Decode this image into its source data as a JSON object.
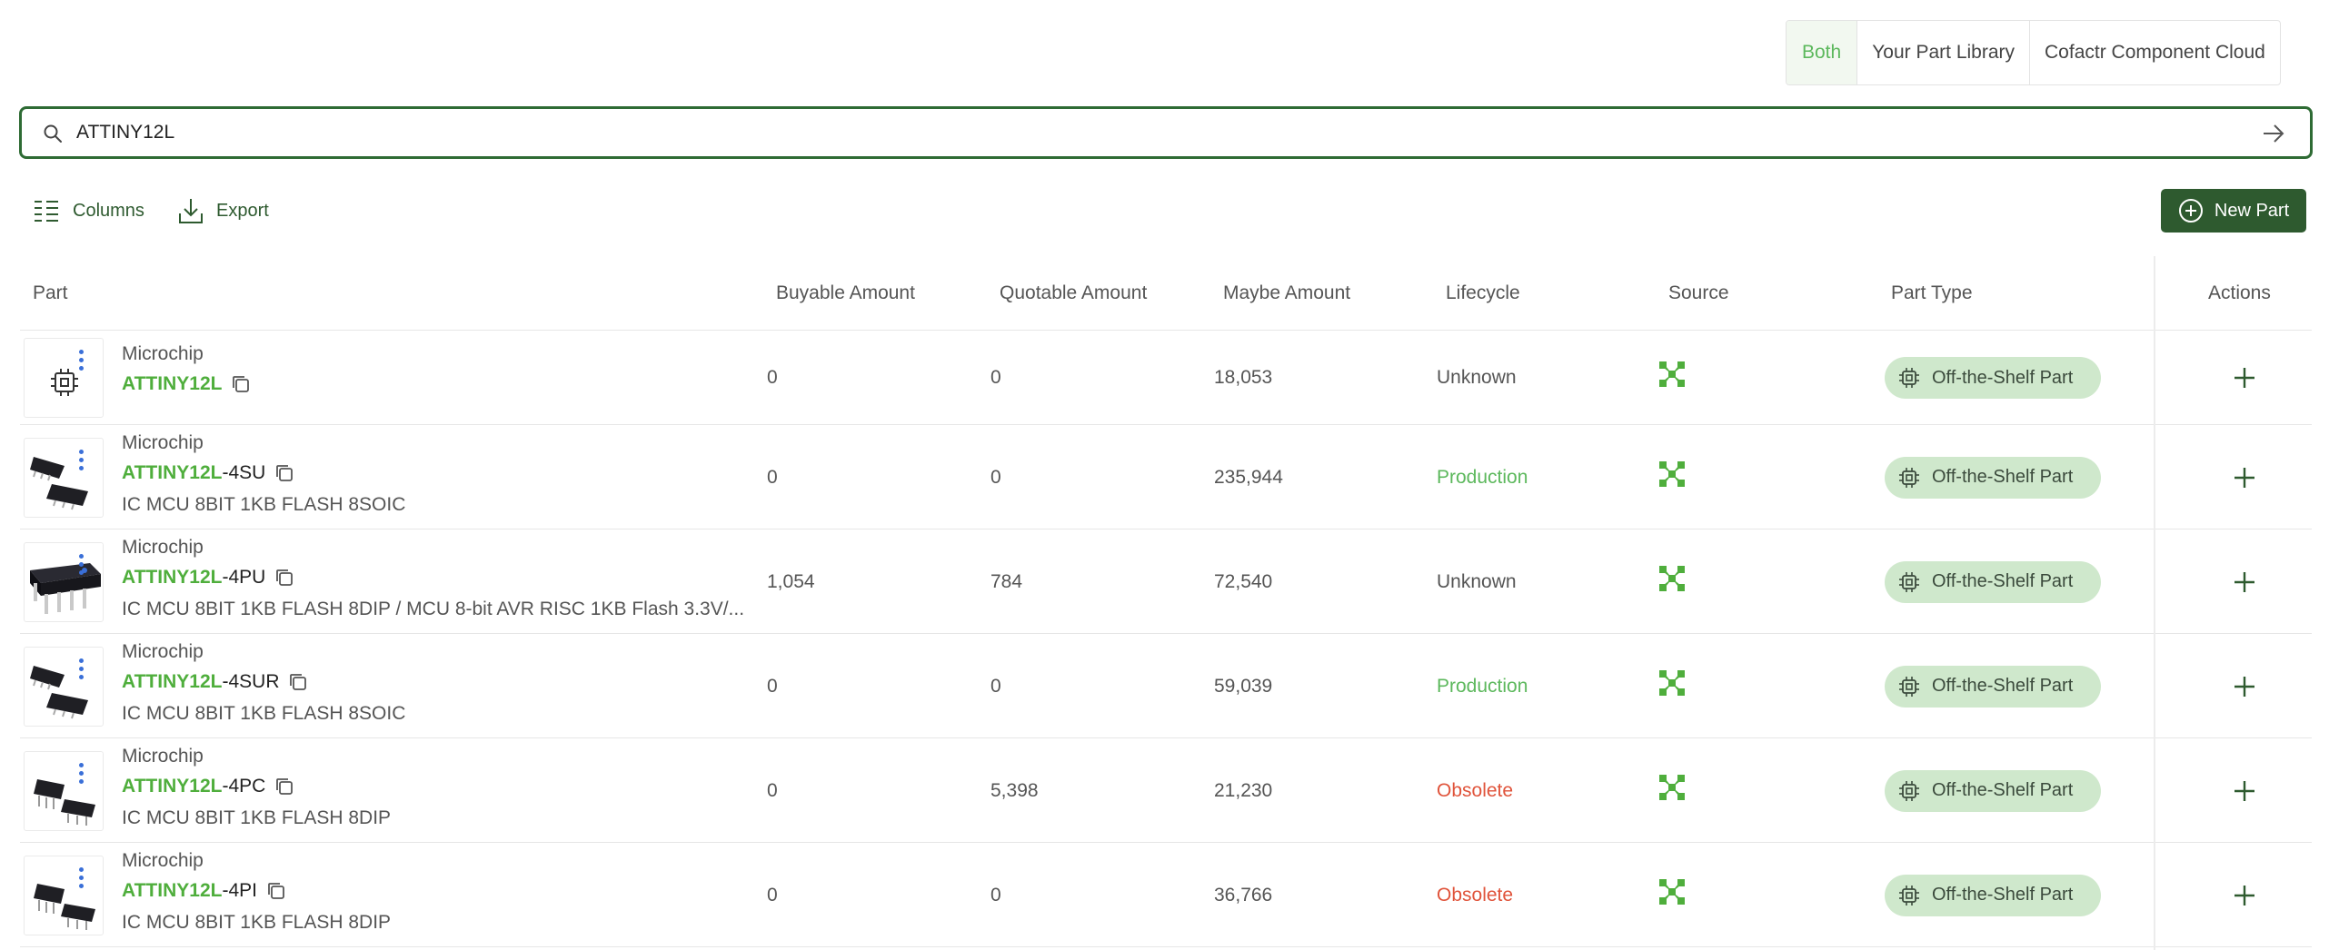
{
  "source_toggle": {
    "options": [
      "Both",
      "Your Part Library",
      "Cofactr Component Cloud"
    ],
    "selected": "Both"
  },
  "search": {
    "value": "ATTINY12L",
    "icon": "search-icon",
    "submit_icon": "arrow-right-icon"
  },
  "toolbar": {
    "columns_label": "Columns",
    "export_label": "Export",
    "new_part_label": "New Part"
  },
  "table": {
    "headers": {
      "part": "Part",
      "buyable": "Buyable Amount",
      "quotable": "Quotable Amount",
      "maybe": "Maybe Amount",
      "lifecycle": "Lifecycle",
      "source": "Source",
      "part_type": "Part Type",
      "actions": "Actions"
    },
    "rows": [
      {
        "manufacturer": "Microchip",
        "pn_match": "ATTINY12L",
        "pn_rest": "",
        "description": "",
        "buyable": "0",
        "quotable": "0",
        "maybe": "18,053",
        "lifecycle": "Unknown",
        "part_type": "Off-the-Shelf Part",
        "image": "chip-icon"
      },
      {
        "manufacturer": "Microchip",
        "pn_match": "ATTINY12L",
        "pn_rest": "-4SU",
        "description": "IC MCU 8BIT 1KB FLASH 8SOIC",
        "buyable": "0",
        "quotable": "0",
        "maybe": "235,944",
        "lifecycle": "Production",
        "part_type": "Off-the-Shelf Part",
        "image": "soic-package"
      },
      {
        "manufacturer": "Microchip",
        "pn_match": "ATTINY12L",
        "pn_rest": "-4PU",
        "description": "IC MCU 8BIT 1KB FLASH 8DIP / MCU 8-bit AVR RISC 1KB Flash 3.3V/...",
        "buyable": "1,054",
        "quotable": "784",
        "maybe": "72,540",
        "lifecycle": "Unknown",
        "part_type": "Off-the-Shelf Part",
        "image": "dip-package"
      },
      {
        "manufacturer": "Microchip",
        "pn_match": "ATTINY12L",
        "pn_rest": "-4SUR",
        "description": "IC MCU 8BIT 1KB FLASH 8SOIC",
        "buyable": "0",
        "quotable": "0",
        "maybe": "59,039",
        "lifecycle": "Production",
        "part_type": "Off-the-Shelf Part",
        "image": "soic-package"
      },
      {
        "manufacturer": "Microchip",
        "pn_match": "ATTINY12L",
        "pn_rest": "-4PC",
        "description": "IC MCU 8BIT 1KB FLASH 8DIP",
        "buyable": "0",
        "quotable": "5,398",
        "maybe": "21,230",
        "lifecycle": "Obsolete",
        "part_type": "Off-the-Shelf Part",
        "image": "dip-package-small"
      },
      {
        "manufacturer": "Microchip",
        "pn_match": "ATTINY12L",
        "pn_rest": "-4PI",
        "description": "IC MCU 8BIT 1KB FLASH 8DIP",
        "buyable": "0",
        "quotable": "0",
        "maybe": "36,766",
        "lifecycle": "Obsolete",
        "part_type": "Off-the-Shelf Part",
        "image": "dip-package-small"
      }
    ]
  },
  "colors": {
    "accent_green": "#4fae3c",
    "dark_green": "#2e5a2f",
    "obsolete_red": "#e0533a",
    "badge_bg": "#cfe8cc"
  }
}
